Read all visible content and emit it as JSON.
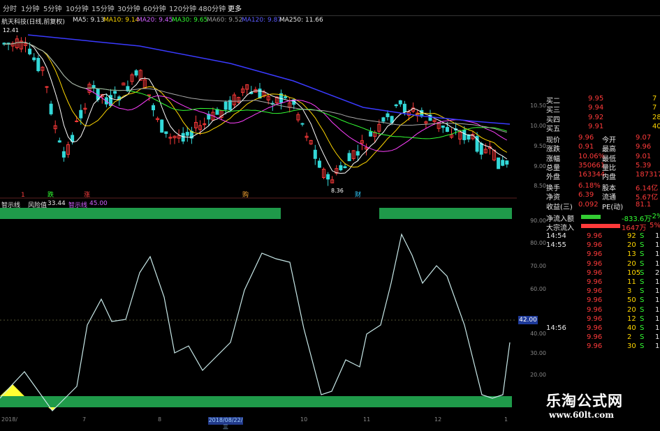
{
  "toolbar": {
    "items": [
      "分时",
      "1分钟",
      "5分钟",
      "10分钟",
      "15分钟",
      "30分钟",
      "60分钟",
      "120分钟",
      "480分钟",
      "更多"
    ]
  },
  "ma_bar": {
    "stock": "航天科技(日线,前复权)",
    "ma5": "MA5: 9.13",
    "ma10": "MA10: 9.14",
    "ma20": "MA20: 9.45",
    "ma30": "MA30: 9.65",
    "ma60": "MA60: 9.52",
    "ma120": "MA120: 9.87",
    "ma250": "MA250: 11.66",
    "high_label": "12.41",
    "low_label": "8.36"
  },
  "indicator_bar": {
    "name": "智示线",
    "risk": "风险值",
    "risk_value": "33.44",
    "line": "智示线",
    "line_value": "45.00"
  },
  "quote": {
    "rows": [
      {
        "label": "买二",
        "price": "9.95",
        "vol": "7"
      },
      {
        "label": "买三",
        "price": "9.94",
        "vol": "7"
      },
      {
        "label": "买四",
        "price": "9.92",
        "vol": "28"
      },
      {
        "label": "买五",
        "price": "9.91",
        "vol": "40"
      },
      {
        "label": "现价",
        "price": "9.96",
        "k2": "今开",
        "v2": "9.07"
      },
      {
        "label": "涨跌",
        "price": "0.91",
        "k2": "最高",
        "v2": "9.96"
      },
      {
        "label": "涨幅",
        "price": "10.06%",
        "k2": "最低",
        "v2": "9.01"
      },
      {
        "label": "总量",
        "price": "350661",
        "k2": "量比",
        "v2": "5.39"
      },
      {
        "label": "外盘",
        "price": "163344",
        "k2": "内盘",
        "v2": "187317"
      },
      {
        "label": "换手",
        "price": "6.18%",
        "k2": "股本",
        "v2": "6.14亿"
      },
      {
        "label": "净资",
        "price": "6.39",
        "k2": "流通",
        "v2": "5.67亿"
      },
      {
        "label": "收益(三)",
        "price": "0.092",
        "k2": "PE(动)",
        "v2": "81.1"
      }
    ],
    "flow1": {
      "label": "净流入额",
      "value": "-833.6万",
      "pct": "-2%"
    },
    "flow2": {
      "label": "大宗流入",
      "value": "1647万",
      "pct": "5%"
    },
    "ticks": [
      {
        "t": "14:54",
        "p": "9.96",
        "v": "92",
        "s": "S",
        "n": "1"
      },
      {
        "t": "14:55",
        "p": "9.96",
        "v": "20",
        "s": "S",
        "n": "1"
      },
      {
        "t": "",
        "p": "9.96",
        "v": "13",
        "s": "S",
        "n": "1"
      },
      {
        "t": "",
        "p": "9.96",
        "v": "20",
        "s": "S",
        "n": "1"
      },
      {
        "t": "",
        "p": "9.96",
        "v": "105",
        "s": "S",
        "n": "2"
      },
      {
        "t": "",
        "p": "9.96",
        "v": "11",
        "s": "S",
        "n": "1"
      },
      {
        "t": "",
        "p": "9.96",
        "v": "3",
        "s": "S",
        "n": "1"
      },
      {
        "t": "",
        "p": "9.96",
        "v": "50",
        "s": "S",
        "n": "1"
      },
      {
        "t": "",
        "p": "9.96",
        "v": "20",
        "s": "S",
        "n": "1"
      },
      {
        "t": "",
        "p": "9.96",
        "v": "12",
        "s": "S",
        "n": "1"
      },
      {
        "t": "14:56",
        "p": "9.96",
        "v": "40",
        "s": "S",
        "n": "1"
      },
      {
        "t": "",
        "p": "9.96",
        "v": "2",
        "s": "S",
        "n": "1"
      },
      {
        "t": "",
        "p": "9.96",
        "v": "30",
        "s": "S",
        "n": "1"
      }
    ]
  },
  "price_axis": [
    "10.50",
    "10.00",
    "9.50",
    "9.00",
    "8.50"
  ],
  "ind_axis": [
    "90.00",
    "80.00",
    "70.00",
    "60.00",
    "50.00",
    "40.00",
    "30.00",
    "20.00"
  ],
  "ind_current": "42.00",
  "dates": [
    "2018/",
    "7",
    "8",
    "2018/08/22/三",
    "10",
    "11",
    "12",
    "1"
  ],
  "watermark": {
    "cn": "乐淘公式网",
    "url": "www.60lt.com"
  },
  "markers": {
    "m1": "1",
    "m2": "跌",
    "m3": "涨",
    "m4": "购",
    "m5": "财"
  },
  "colors": {
    "up": "#ff3a3a",
    "down": "#33d8d8",
    "ma5": "#ffffff",
    "ma10": "#ffd700",
    "ma20": "#ff40ff",
    "ma30": "#33ff33",
    "ma60": "#aaaaaa",
    "ma120": "#3a3aff",
    "band": "#1f9a4a",
    "fill": "#ffff33"
  }
}
